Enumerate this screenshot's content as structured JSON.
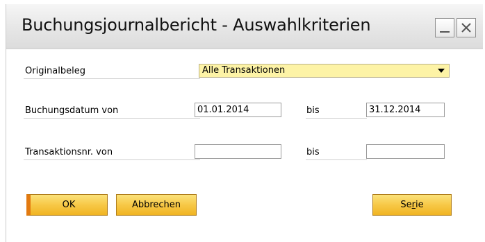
{
  "window": {
    "title": "Buchungsjournalbericht - Auswahlkriterien"
  },
  "form": {
    "original_label": "Originalbeleg",
    "original_value": "Alle Transaktionen",
    "date_label": "Buchungsdatum von",
    "date_from": "01.01.2014",
    "date_bis": "bis",
    "date_to": "31.12.2014",
    "trans_label": "Transaktionsnr. von",
    "trans_from": "",
    "trans_bis": "bis",
    "trans_to": ""
  },
  "buttons": {
    "ok": "OK",
    "cancel": "Abbrechen",
    "serie_pre": "Se",
    "serie_u": "r",
    "serie_post": "ie"
  },
  "colors": {
    "combo_bg": "#fdf3a6",
    "button_bg": "#f7c847",
    "ok_accent": "#e37a10"
  },
  "icons": [
    "minimize-icon",
    "close-icon",
    "dropdown-arrow-icon"
  ]
}
